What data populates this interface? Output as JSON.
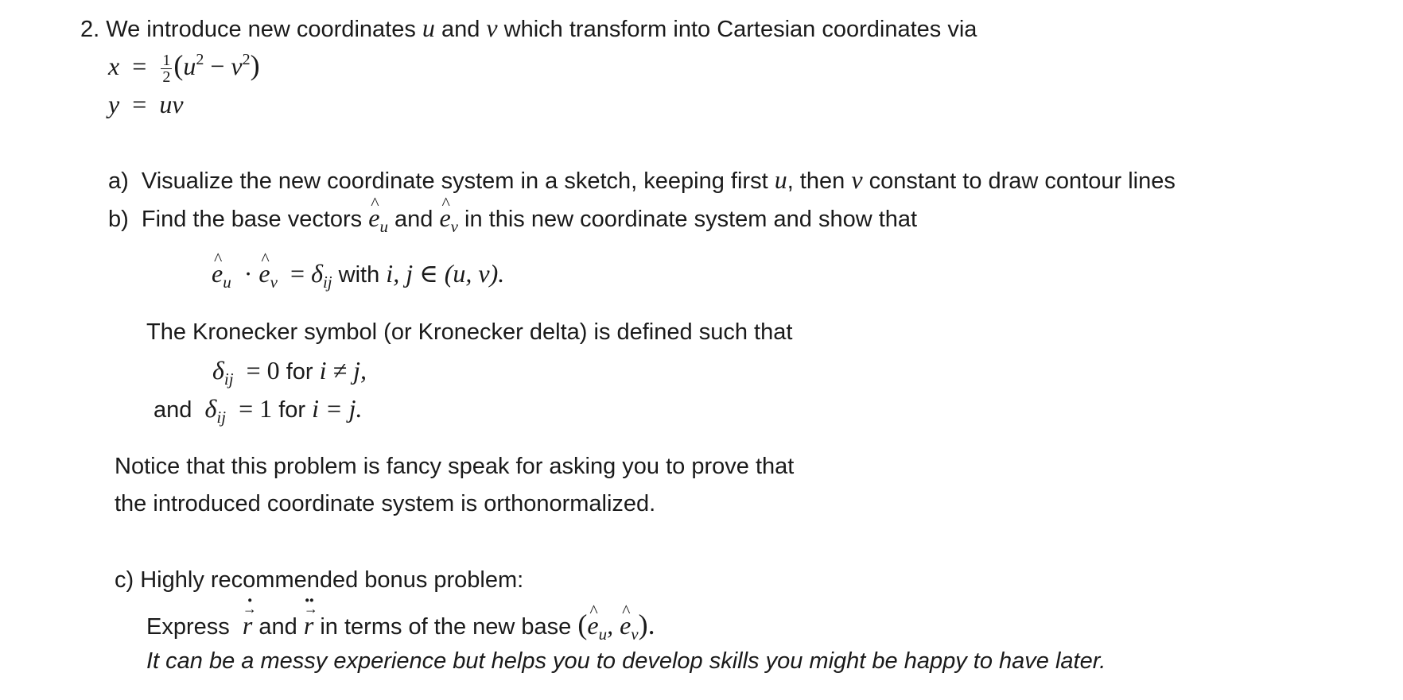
{
  "problem": {
    "number": "2.",
    "intro_before_u": "We introduce new coordinates ",
    "var_u": "u",
    "and": " and ",
    "var_v": "v",
    "intro_after_v": " which transform into Cartesian coordinates via",
    "eq_x": {
      "lhs": "x",
      "eq": "=",
      "frac_num": "1",
      "frac_den": "2",
      "open": "(",
      "u": "u",
      "u_exp": "2",
      "minus": "−",
      "v": "v",
      "v_exp": "2",
      "close": ")"
    },
    "eq_y": {
      "lhs": "y",
      "eq": "=",
      "rhs": "uv"
    }
  },
  "part_a": {
    "label": "a)",
    "text_before": "Visualize the new coordinate system in a sketch, keeping first ",
    "var_u": "u",
    "text_mid": ", then ",
    "var_v": "v",
    "text_after": " constant to draw contour lines"
  },
  "part_b": {
    "label": "b)",
    "text_before": "Find the base vectors ",
    "e": "e",
    "sub_u": "u",
    "and": " and ",
    "sub_v": "v",
    "text_after": " in this new coordinate system and show that",
    "equation": {
      "dot": "·",
      "eq": "=",
      "delta": "δ",
      "delta_sub": "ij",
      "with": " with ",
      "ij": "i, j",
      "in": "∈",
      "set": "(u, v)."
    },
    "kronecker_intro": "The Kronecker symbol (or Kronecker delta) is defined such that",
    "kronecker_lines": [
      {
        "prefix": "",
        "delta": "δ",
        "sub": "ij",
        "eq": "=",
        "value": "0",
        "for": " for ",
        "cond": "i ≠ j,"
      },
      {
        "prefix": "and",
        "delta": "δ",
        "sub": "ij",
        "eq": "=",
        "value": "1",
        "for": " for ",
        "cond": "i = j."
      }
    ],
    "notice_lines": [
      "Notice that this problem is fancy speak for asking you to prove that",
      "the introduced coordinate system is orthonormalized."
    ]
  },
  "part_c": {
    "label": "c)",
    "title": "Highly recommended bonus problem:",
    "express": "Express ",
    "r": "r",
    "and": " and ",
    "text_after": " in terms of the new base ",
    "open": "(",
    "e": "e",
    "sub_u": "u",
    "comma": ", ",
    "sub_v": "v",
    "close": ").",
    "note": "It can be a messy experience but helps you to develop skills you might be happy to have later."
  }
}
